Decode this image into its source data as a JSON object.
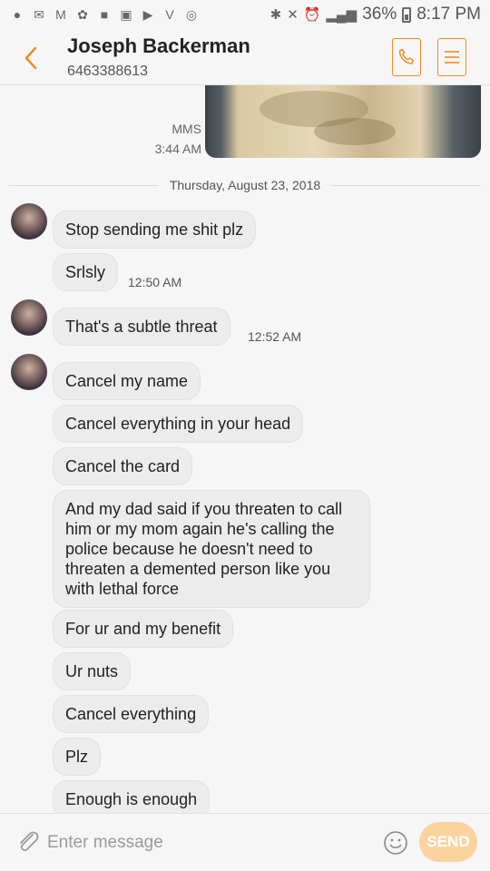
{
  "status_bar": {
    "battery": "36%",
    "time": "8:17 PM"
  },
  "header": {
    "contact_name": "Joseph Backerman",
    "contact_number": "6463388613",
    "accent_color": "#f08a24"
  },
  "conversation": {
    "mms_label": "MMS",
    "mms_time": "3:44 AM",
    "date_separator": "Thursday, August 23, 2018",
    "messages": [
      {
        "text": "Stop sending me shit plz",
        "time": ""
      },
      {
        "text": "Srlsly",
        "time": "12:50 AM"
      },
      {
        "text": "That's a subtle threat",
        "time": "12:52 AM"
      },
      {
        "text": "Cancel my name",
        "time": ""
      },
      {
        "text": "Cancel everything in your head",
        "time": ""
      },
      {
        "text": "Cancel the card",
        "time": ""
      },
      {
        "text": "And my dad said if you threaten to call him or my mom again he's calling the police because he doesn't need to threaten a demented person like you with lethal force",
        "time": ""
      },
      {
        "text": "For ur and my benefit",
        "time": ""
      },
      {
        "text": "Ur nuts",
        "time": ""
      },
      {
        "text": "Cancel everything",
        "time": ""
      },
      {
        "text": "Plz",
        "time": ""
      },
      {
        "text": "Enough is enough",
        "time": ""
      }
    ]
  },
  "input_bar": {
    "placeholder": "Enter message",
    "send_label": "SEND",
    "send_color": "#fbd39f"
  }
}
